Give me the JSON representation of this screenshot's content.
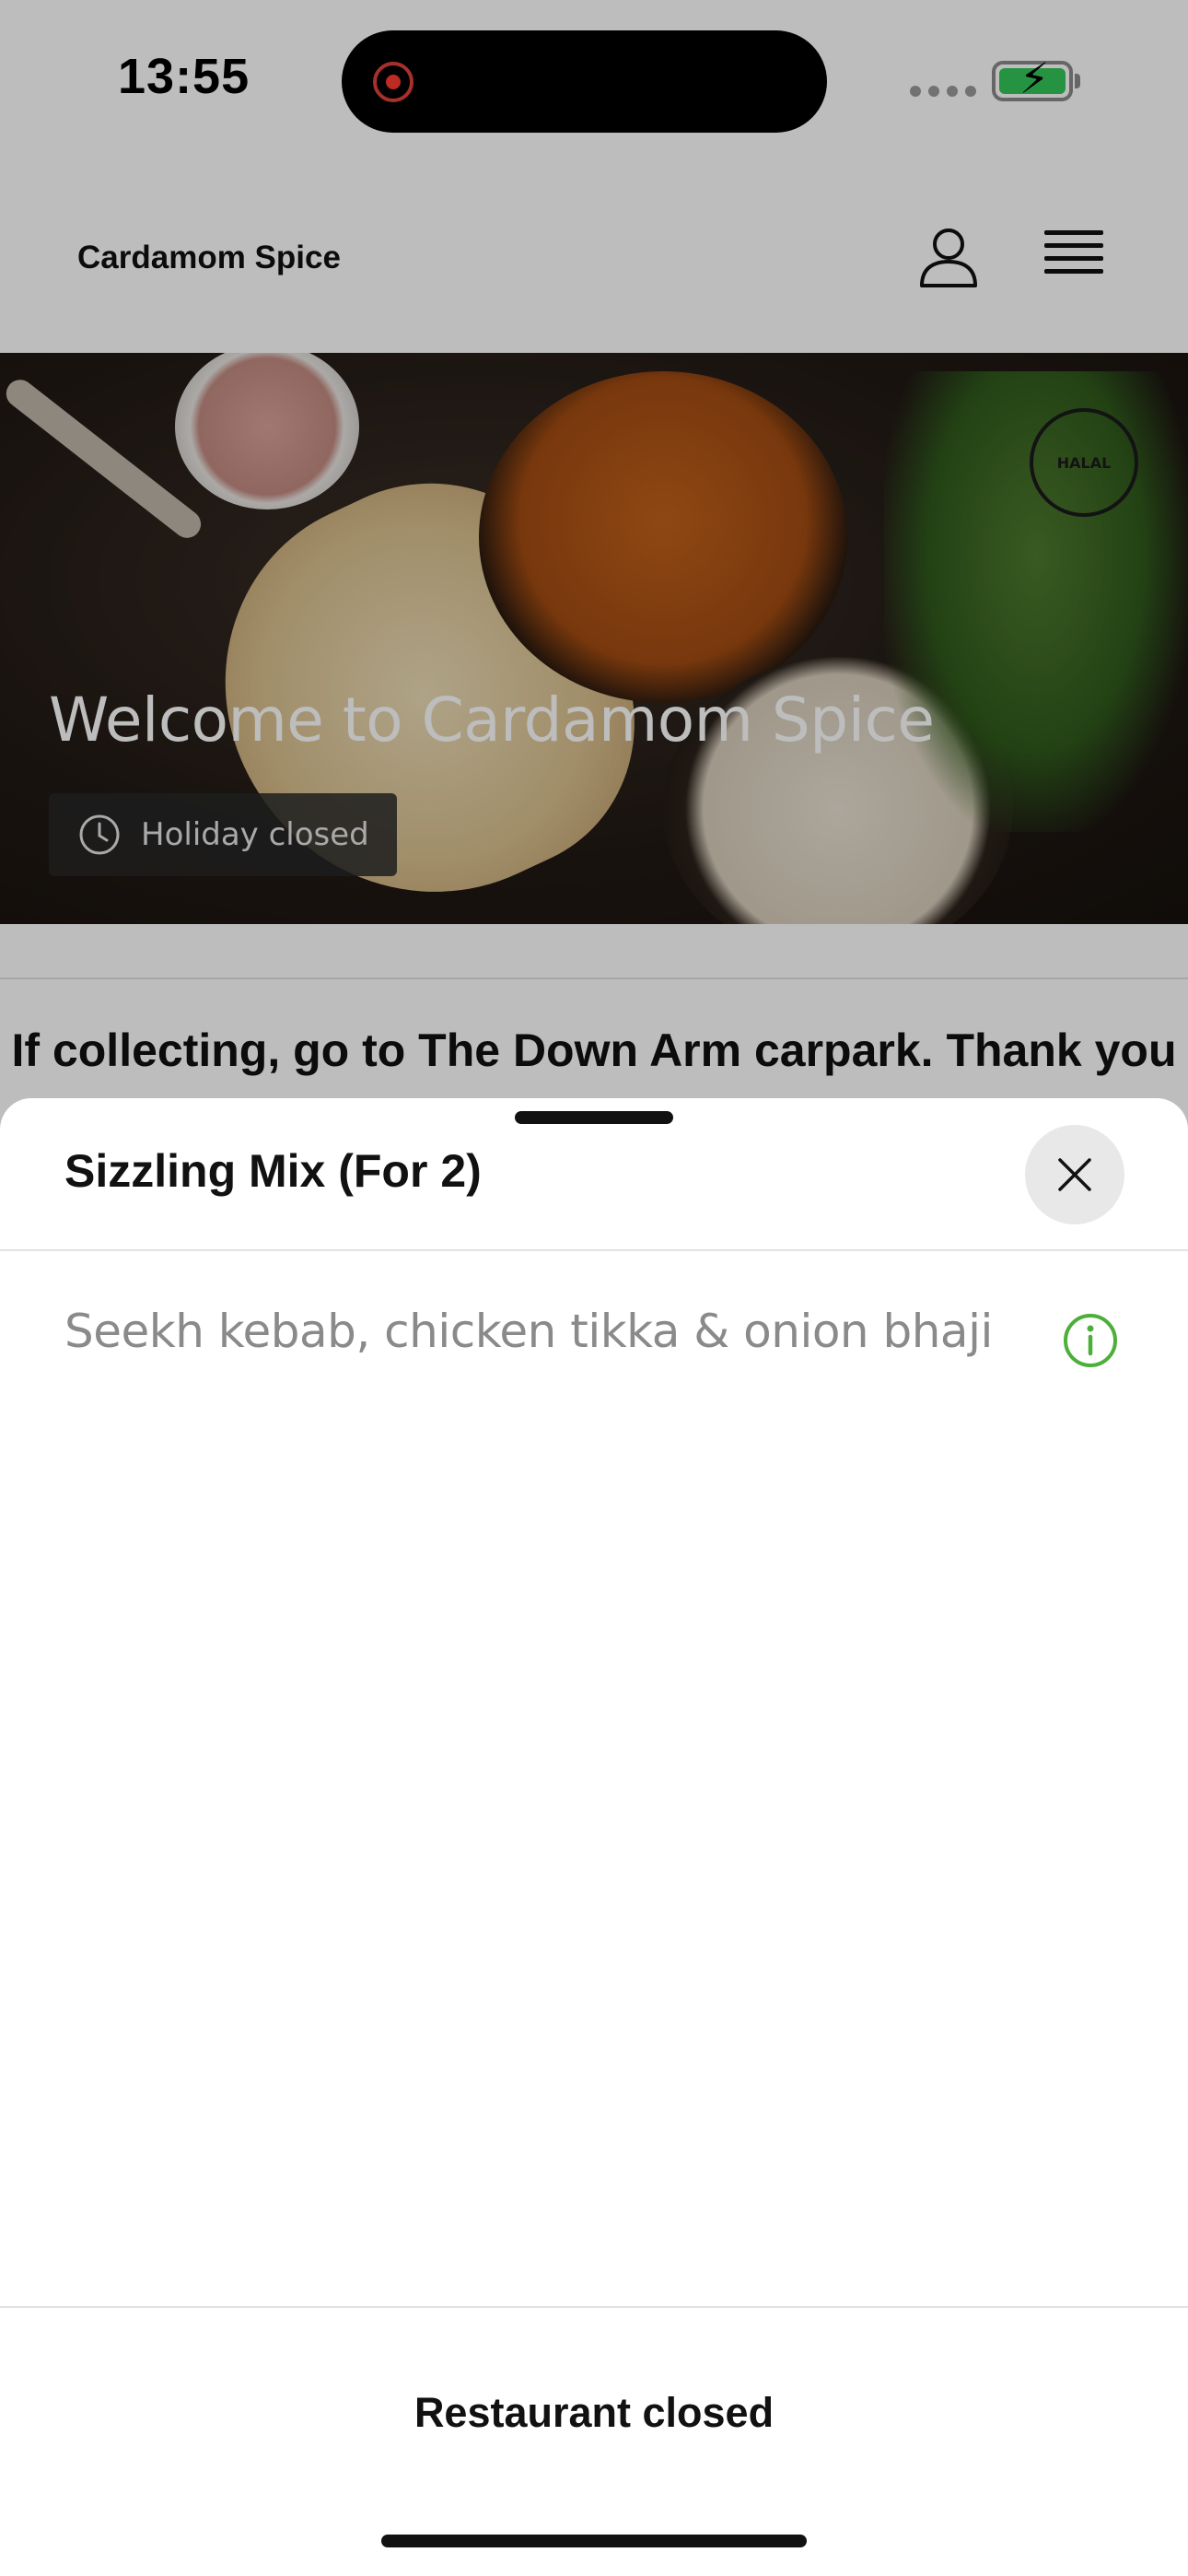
{
  "status_bar": {
    "time": "13:55"
  },
  "header": {
    "brand": "Cardamom Spice",
    "account_icon": "person-icon",
    "menu_icon": "hamburger-menu-icon"
  },
  "hero": {
    "title": "Welcome to Cardamom Spice",
    "badge_icon": "clock-icon",
    "badge_text": "Holiday closed",
    "halal_logo_text": "HALAL"
  },
  "notice": {
    "text": "If collecting, go to The Down Arm carpark. Thank you"
  },
  "sheet": {
    "title": "Sizzling Mix (For 2)",
    "close_icon": "close-icon",
    "description": "Seekh kebab, chicken tikka & onion bhaji",
    "info_icon": "info-icon",
    "info_icon_color": "#4caf3a",
    "footer_status": "Restaurant closed"
  },
  "colors": {
    "battery": "#34c759",
    "recording": "#ff3b30",
    "overlay": "rgba(0,0,0,0.26)"
  }
}
